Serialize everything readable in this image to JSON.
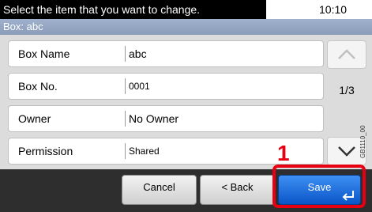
{
  "header": {
    "message": "Select the item that you want to change.",
    "time": "10:10",
    "box_title": "Box: abc"
  },
  "rows": [
    {
      "label": "Box Name",
      "value": "abc"
    },
    {
      "label": "Box No.",
      "value": "0001"
    },
    {
      "label": "Owner",
      "value": "No Owner"
    },
    {
      "label": "Permission",
      "value": "Shared"
    }
  ],
  "pager": {
    "page_indicator": "1/3",
    "up_icon": "chevron-up-icon",
    "down_icon": "chevron-down-icon"
  },
  "footer": {
    "cancel_label": "Cancel",
    "back_label": "< Back",
    "save_label": "Save",
    "save_icon": "enter-icon"
  },
  "annotations": {
    "callout_number": "1",
    "callout_color": "#e60012",
    "watermark": "GB1110_00"
  },
  "colors": {
    "accent": "#0a55c8",
    "subbar": "#8a9cb8"
  }
}
